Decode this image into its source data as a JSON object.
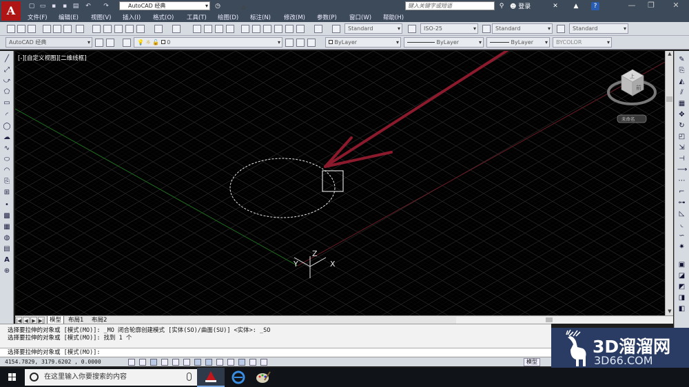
{
  "app": {
    "logo_letter": "A",
    "workspace": "AutoCAD 经典",
    "search_placeholder": "键入关键字或短语",
    "login": "登录"
  },
  "menu": [
    "文件(F)",
    "编辑(E)",
    "视图(V)",
    "插入(I)",
    "格式(O)",
    "工具(T)",
    "绘图(D)",
    "标注(N)",
    "修改(M)",
    "参数(P)",
    "窗口(W)",
    "帮助(H)"
  ],
  "toolbar_styles": {
    "text_style": "Standard",
    "dim_style": "ISO-25",
    "table_style": "Standard",
    "mleader_style": "Standard"
  },
  "properties": {
    "workspace": "AutoCAD 经典",
    "layer": "0",
    "color": "ByLayer",
    "linetype": "ByLayer",
    "lineweight": "ByLayer",
    "plotstyle": "BYCOLOR"
  },
  "viewport": {
    "label": "[-][自定义视图][二维线框]",
    "ucs": {
      "x": "X",
      "y": "Y",
      "z": "Z"
    },
    "viewcube_face": "前",
    "viewcube_top": "上",
    "wcs_label": "未命名"
  },
  "tabs": [
    "模型",
    "布局1",
    "布局2"
  ],
  "command": {
    "lines": [
      "选择要拉伸的对象或 [模式(MO)]: _MO 闭合轮廓创建模式 [实体(SO)/曲面(SU)] <实体>: _SO",
      "选择要拉伸的对象或 [模式(MO)]: 找到 1 个",
      "选择要拉伸的对象或 [模式(MO)]:"
    ]
  },
  "status": {
    "coords": "4154.7829, 3179.6202 , 0.0000",
    "model": "模型"
  },
  "watermark": {
    "title": "3D溜溜网",
    "sub": "3D66.COM"
  },
  "taskbar": {
    "search": "在这里输入你要搜索的内容"
  },
  "colors": {
    "arrow": "#8b1a2c",
    "x_axis": "#7a1f2a",
    "y_axis": "#1f7a1f",
    "grid": "#1b1b1b"
  }
}
